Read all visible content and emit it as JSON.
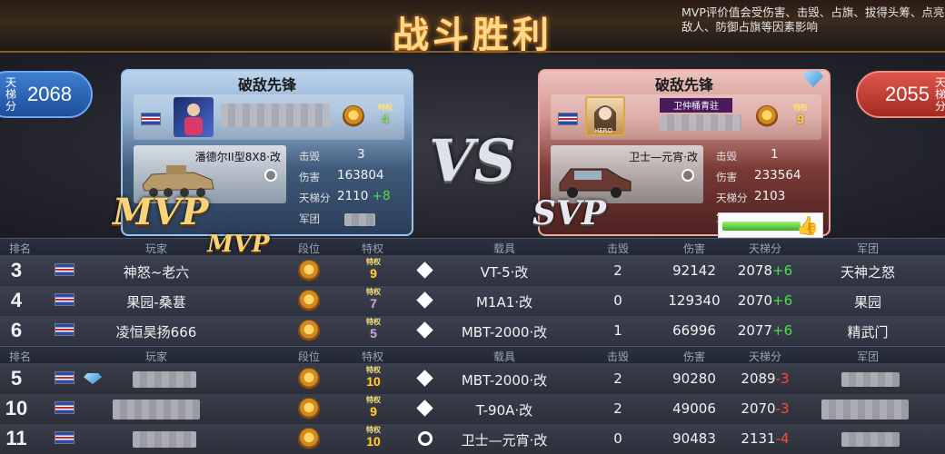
{
  "header": {
    "title": "战斗胜利",
    "mvp_note": "MVP评价值会受伤害、击毁、占旗、拔得头筹、点亮敌人、防御占旗等因素影响"
  },
  "left_side": {
    "ladder_label": "天梯分",
    "ladder_value": "2068",
    "card_title": "破敌先锋",
    "privilege_label": "特权",
    "privilege_level": "4",
    "vehicle": "潘德尔II型8X8·改",
    "stats": {
      "kills_label": "击毁",
      "kills": "3",
      "damage_label": "伤害",
      "damage": "163804",
      "ladder_label": "天梯分",
      "ladder": "2110",
      "ladder_delta": "+8",
      "team_label": "军团"
    },
    "tag": "MVP"
  },
  "right_side": {
    "ladder_label": "天梯分",
    "ladder_value": "2055",
    "card_title": "破敌先锋",
    "avatar_label": "HERO",
    "name_tag": "卫仲桶青驻",
    "privilege_label": "特权",
    "privilege_level": "9",
    "vehicle": "卫士—元宵·改",
    "stats": {
      "kills_label": "击毁",
      "kills": "1",
      "damage_label": "伤害",
      "damage": "233564",
      "ladder_label": "天梯分",
      "ladder": "2103",
      "team_label": "军团"
    },
    "tag": "SVP",
    "like_icon": "thumbs-up-icon"
  },
  "vs_label": "VS",
  "table_mvp_tag": "MVP",
  "columns": {
    "rank": "排名",
    "player": "玩家",
    "tier": "段位",
    "privilege": "特权",
    "vehicle": "载具",
    "kills": "击毁",
    "damage": "伤害",
    "ladder": "天梯分",
    "team": "军团"
  },
  "team1_rows": [
    {
      "rank": "3",
      "name": "神怒~老六",
      "priv_label": "特权",
      "priv": "9",
      "vehicle": "VT-5·改",
      "vicon": "diamond",
      "kills": "2",
      "damage": "92142",
      "ladder": "2078",
      "delta": "+6",
      "team": "天神之怒"
    },
    {
      "rank": "4",
      "name": "果园-桑葚",
      "priv_label": "特权",
      "priv": "7",
      "vehicle": "M1A1·改",
      "vicon": "diamond",
      "kills": "0",
      "damage": "129340",
      "ladder": "2070",
      "delta": "+6",
      "team": "果园"
    },
    {
      "rank": "6",
      "name": "凌恒昊扬666",
      "priv_label": "特权",
      "priv": "5",
      "vehicle": "MBT-2000·改",
      "vicon": "diamond",
      "kills": "1",
      "damage": "66996",
      "ladder": "2077",
      "delta": "+6",
      "team": "精武门"
    }
  ],
  "team2_rows": [
    {
      "rank": "5",
      "priv_label": "特权",
      "priv": "10",
      "vehicle": "MBT-2000·改",
      "vicon": "diamond",
      "kills": "2",
      "damage": "90280",
      "ladder": "2089",
      "delta": "-3"
    },
    {
      "rank": "10",
      "priv_label": "特权",
      "priv": "9",
      "vehicle": "T-90A·改",
      "vicon": "diamond",
      "kills": "2",
      "damage": "49006",
      "ladder": "2070",
      "delta": "-3"
    },
    {
      "rank": "11",
      "priv_label": "特权",
      "priv": "10",
      "vehicle": "卫士—元宵·改",
      "vicon": "ring",
      "kills": "0",
      "damage": "90483",
      "ladder": "2131",
      "delta": "-4"
    }
  ]
}
